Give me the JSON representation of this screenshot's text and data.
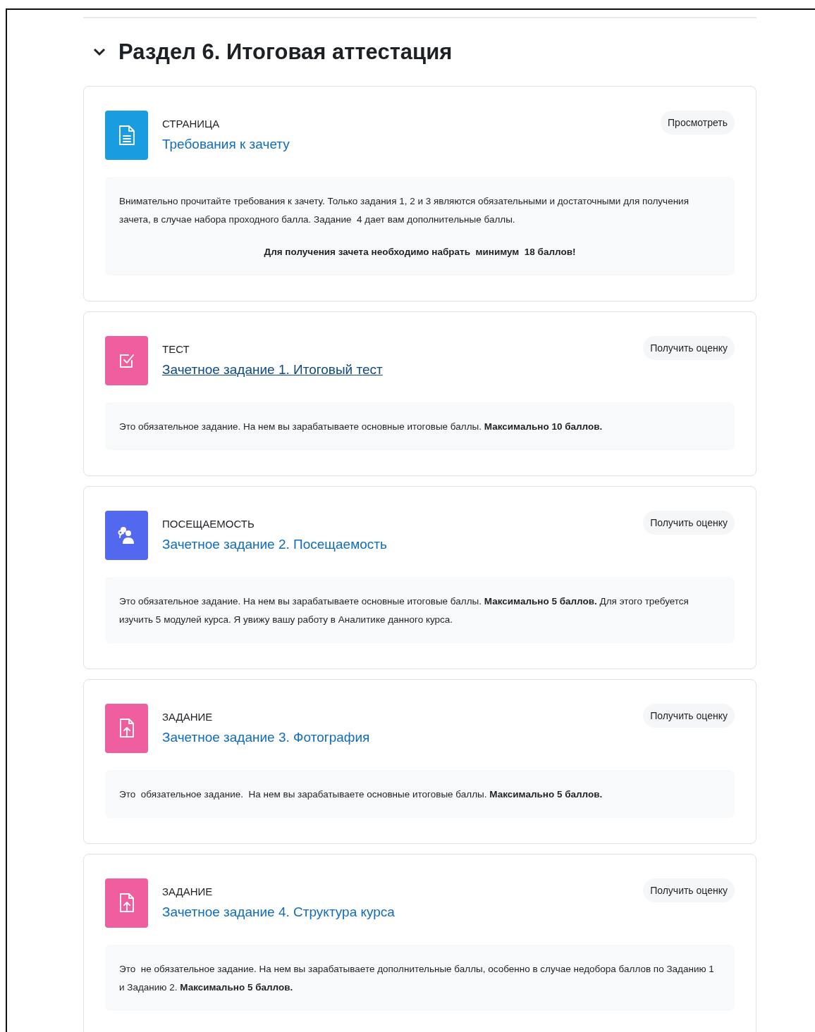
{
  "section": {
    "title": "Раздел 6. Итоговая аттестация",
    "expanded": true
  },
  "activities": [
    {
      "kind": "page",
      "type_label": "СТРАНИЦА",
      "title": "Требования к зачету",
      "hovered": false,
      "action": "Просмотреть",
      "description": [
        {
          "kind": "text",
          "text": "Внимательно прочитайте требования к зачету. Только задания 1, 2 и 3 являются обязательными и достаточными для получения зачета, в случае набора проходного балла. Задание  4 дает вам дополнительные баллы."
        },
        {
          "kind": "emphasis",
          "text": "Для получения зачета необходимо набрать  минимум  18 баллов!"
        }
      ]
    },
    {
      "kind": "quiz",
      "type_label": "ТЕСТ",
      "title": "Зачетное задание 1. Итоговый тест",
      "hovered": true,
      "action": "Получить оценку",
      "description": [
        {
          "kind": "text",
          "text": "Это обязательное задание. На нем вы зарабатываете основные итоговые баллы. **Максимально 10 баллов.**"
        }
      ]
    },
    {
      "kind": "attendance",
      "type_label": "ПОСЕЩАЕМОСТЬ",
      "title": "Зачетное задание 2. Посещаемость",
      "hovered": false,
      "action": "Получить оценку",
      "description": [
        {
          "kind": "text",
          "text": "Это обязательное задание. На нем вы зарабатываете основные итоговые баллы. **Максимально 5 баллов.** Для этого требуется  изучить 5 модулей курса. Я увижу вашу работу в Аналитике данного курса."
        }
      ]
    },
    {
      "kind": "assign",
      "type_label": "ЗАДАНИЕ",
      "title": "Зачетное задание 3. Фотография",
      "hovered": false,
      "action": "Получить оценку",
      "description": [
        {
          "kind": "text",
          "text": "Это  обязательное задание.  На нем вы зарабатываете основные итоговые баллы. **Максимально 5 баллов.**"
        }
      ]
    },
    {
      "kind": "assign",
      "type_label": "ЗАДАНИЕ",
      "title": "Зачетное задание 4. Структура курса",
      "hovered": false,
      "action": "Получить оценку",
      "description": [
        {
          "kind": "text",
          "text": "Это  не обязательное задание. На нем вы зарабатываете дополнительные баллы, особенно в случае недобора баллов по Заданию 1 и Заданию 2. **Максимально 5 баллов.**"
        }
      ]
    }
  ]
}
